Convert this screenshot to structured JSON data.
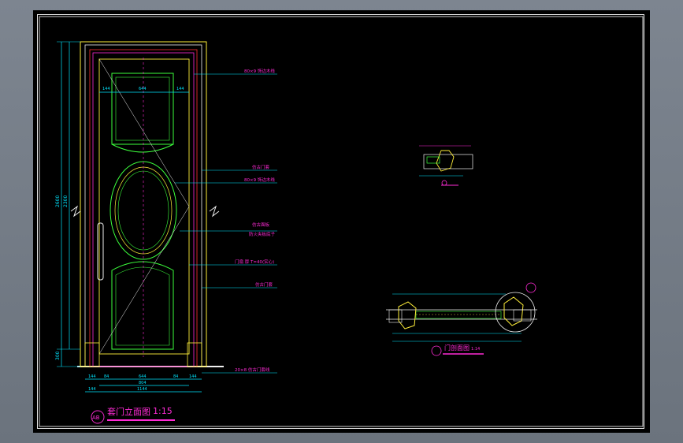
{
  "drawing": {
    "elevation_title": "套门立面图",
    "elevation_scale": "1:15",
    "elevation_marker": "AB",
    "section_title": "门剖面图",
    "section_scale": "1:14",
    "dims_bottom_row1": [
      "144",
      "84",
      "644",
      "84",
      "144"
    ],
    "dims_bottom_row2": [
      "804"
    ],
    "dims_bottom_row3": [
      "144",
      "1144"
    ],
    "dims_top_row": [
      "144",
      "644",
      "144"
    ],
    "dims_left": [
      "2600",
      "2300",
      "300"
    ],
    "callouts": [
      "80×9 饰边木线",
      "仿古门套",
      "80×9 饰边木线",
      "仿古面板",
      "防火夹板底子",
      "门扇 厚 T=40(实心)",
      "仿古门套",
      "20×8 仿古门套线"
    ],
    "colors": {
      "cyan": "#00e5ff",
      "magenta": "#ff2bd6",
      "yellow": "#ffef3a",
      "green": "#3cff3c",
      "red": "#ff3030",
      "white": "#f0f0f0"
    }
  }
}
